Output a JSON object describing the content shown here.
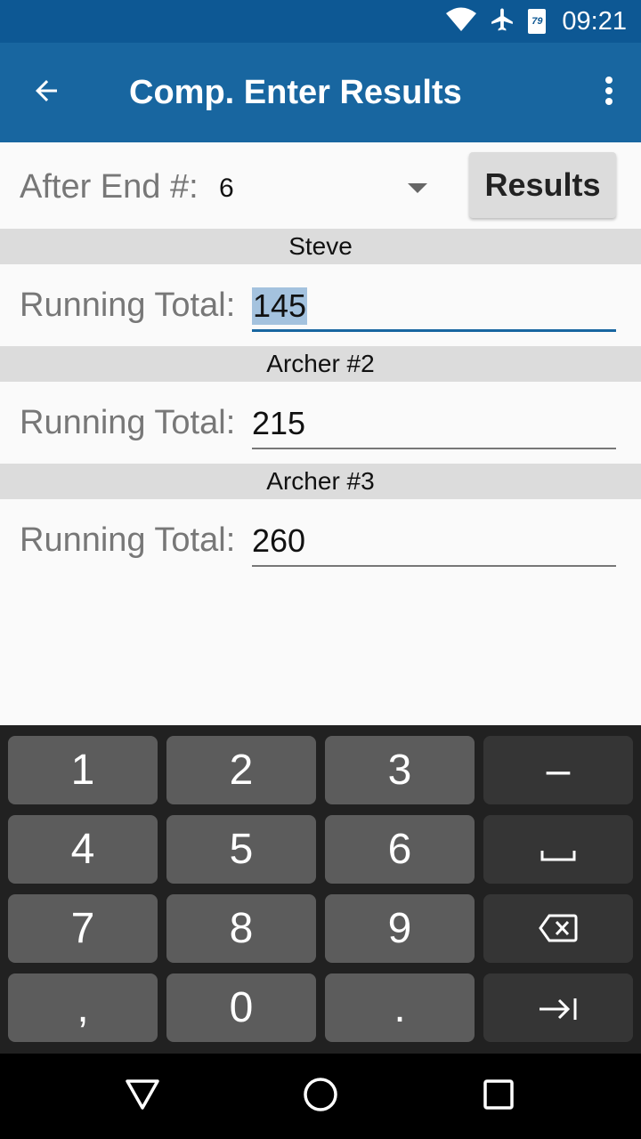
{
  "status_bar": {
    "time": "09:21",
    "calendar_badge": "79",
    "icons": [
      "wifi-icon",
      "airplane-icon",
      "calendar-icon"
    ]
  },
  "app_bar": {
    "title": "Comp. Enter Results",
    "back_icon": "arrow-left-icon",
    "overflow_icon": "more-vert-icon"
  },
  "end_selector": {
    "label": "After End #:",
    "selected": "6"
  },
  "results_button": {
    "label": "Results"
  },
  "archers": [
    {
      "name": "Steve",
      "total_label": "Running Total:",
      "total": "145",
      "focused": true
    },
    {
      "name": "Archer #2",
      "total_label": "Running Total:",
      "total": "215",
      "focused": false
    },
    {
      "name": "Archer #3",
      "total_label": "Running Total:",
      "total": "260",
      "focused": false
    }
  ],
  "keyboard": {
    "keys": [
      "1",
      "2",
      "3",
      "–",
      "4",
      "5",
      "6",
      "",
      "7",
      "8",
      "9",
      "",
      ",",
      "0",
      ".",
      ""
    ],
    "function_keys": [
      "minus",
      "space",
      "backspace",
      "next"
    ]
  },
  "colors": {
    "status_bar": "#0d5894",
    "app_bar": "#1866a0",
    "focus_underline": "#1866a0",
    "selection": "#a4c2de",
    "keyboard_bg": "#212121"
  }
}
